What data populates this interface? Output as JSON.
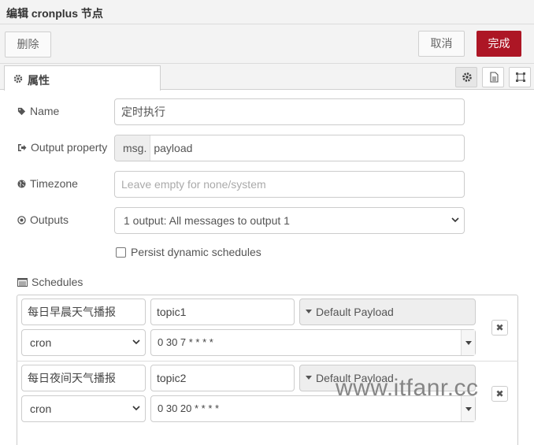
{
  "window": {
    "title": "编辑 cronplus 节点"
  },
  "toolbar": {
    "delete_label": "删除",
    "cancel_label": "取消",
    "done_label": "完成"
  },
  "tabs": [
    {
      "label": "属性",
      "icon": "gear-icon"
    }
  ],
  "tab_icons": [
    "gear-icon",
    "description-icon",
    "appearance-icon"
  ],
  "form": {
    "name": {
      "label": "Name",
      "value": "定时执行",
      "icon": "tag-icon"
    },
    "output_property": {
      "label": "Output property",
      "prefix": "msg.",
      "value": "payload",
      "icon": "sign-out-icon"
    },
    "timezone": {
      "label": "Timezone",
      "placeholder": "Leave empty for none/system",
      "icon": "globe-icon"
    },
    "outputs": {
      "label": "Outputs",
      "value": "1 output: All messages to output 1",
      "icon": "dot-circle-icon"
    },
    "persist": {
      "label": "Persist dynamic schedules",
      "checked": false
    }
  },
  "schedules": {
    "label": "Schedules",
    "icon": "list-alt-icon",
    "rows": [
      {
        "name": "每日早晨天气播报",
        "topic": "topic1",
        "payload": "Default Payload",
        "type": "cron",
        "expression": "0 30 7 * * * *"
      },
      {
        "name": "每日夜间天气播报",
        "topic": "topic2",
        "payload": "Default Payload",
        "type": "cron",
        "expression": "0 30 20 * * * *"
      }
    ],
    "remove_label": "✖"
  },
  "watermark": "www.itfanr.cc",
  "colors": {
    "accent": "#ad1625",
    "panel": "#f3f3f3",
    "border": "#cccccc"
  }
}
